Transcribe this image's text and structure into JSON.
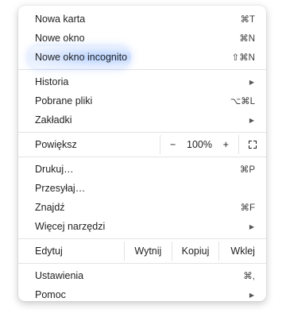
{
  "menu": {
    "group1": [
      {
        "label": "Nowa karta",
        "shortcut": "⌘T"
      },
      {
        "label": "Nowe okno",
        "shortcut": "⌘N"
      },
      {
        "label": "Nowe okno incognito",
        "shortcut": "⇧⌘N"
      }
    ],
    "group2": [
      {
        "label": "Historia",
        "arrow": "▶"
      },
      {
        "label": "Pobrane pliki",
        "shortcut": "⌥⌘L"
      },
      {
        "label": "Zakładki",
        "arrow": "▶"
      }
    ],
    "zoom": {
      "label": "Powiększ",
      "minus": "−",
      "value": "100%",
      "plus": "+"
    },
    "group3": [
      {
        "label": "Drukuj…",
        "shortcut": "⌘P"
      },
      {
        "label": "Przesyłaj…"
      },
      {
        "label": "Znajdź",
        "shortcut": "⌘F"
      },
      {
        "label": "Więcej narzędzi",
        "arrow": "▶"
      }
    ],
    "edit": {
      "label": "Edytuj",
      "cut": "Wytnij",
      "copy": "Kopiuj",
      "paste": "Wklej"
    },
    "group4": [
      {
        "label": "Ustawienia",
        "shortcut": "⌘,"
      },
      {
        "label": "Pomoc",
        "arrow": "▶"
      }
    ],
    "highlight_color": "#8fb4ff"
  }
}
